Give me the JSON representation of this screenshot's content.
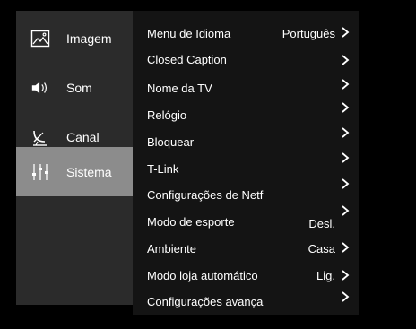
{
  "sidebar": {
    "items": [
      {
        "label": "Imagem",
        "icon": "picture-icon"
      },
      {
        "label": "Som",
        "icon": "speaker-icon"
      },
      {
        "label": "Canal",
        "icon": "satellite-dish-icon"
      },
      {
        "label": "Sistema",
        "icon": "sliders-icon",
        "selected": true
      }
    ]
  },
  "menu": {
    "items": [
      {
        "label": "Menu de Idioma",
        "value": "Português"
      },
      {
        "label": "Closed Caption",
        "value": ""
      },
      {
        "label": "Nome da TV",
        "value": ""
      },
      {
        "label": "Relógio",
        "value": ""
      },
      {
        "label": "Bloquear",
        "value": ""
      },
      {
        "label": "T-Link",
        "value": ""
      },
      {
        "label": "Configurações de Netf",
        "value": ""
      },
      {
        "label": "Modo de esporte",
        "value": "Desl."
      },
      {
        "label": "Ambiente",
        "value": "Casa"
      },
      {
        "label": "Modo loja automático",
        "value": "Lig."
      },
      {
        "label": "Configurações avança",
        "value": ""
      }
    ]
  },
  "colors": {
    "background": "#000000",
    "sidebar_bg": "#2b2b2b",
    "sidebar_selected": "#8c8c8c",
    "panel_bg": "#141414",
    "text": "#ffffff"
  }
}
